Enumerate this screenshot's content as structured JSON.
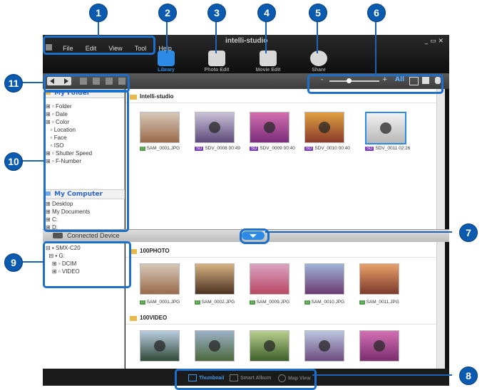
{
  "callouts": [
    "1",
    "2",
    "3",
    "4",
    "5",
    "6",
    "7",
    "8",
    "9",
    "10",
    "11"
  ],
  "app": {
    "menu": [
      "File",
      "Edit",
      "View",
      "Tool",
      "Help"
    ],
    "brand": "intelli-studio",
    "window_controls": [
      "_",
      "▭",
      "✕"
    ]
  },
  "tools": [
    {
      "label": "Library",
      "icon": "library-icon",
      "active": true
    },
    {
      "label": "Photo Edit",
      "icon": "photo-edit-icon",
      "active": false
    },
    {
      "label": "Movie Edit",
      "icon": "movie-edit-icon",
      "active": false
    },
    {
      "label": "Share",
      "icon": "share-icon",
      "active": false
    }
  ],
  "view_controls": {
    "zoom_minus": "-",
    "zoom_plus": "+",
    "all": "All"
  },
  "my_folder": {
    "title": "My Folder",
    "items": [
      "Folder",
      "Date",
      "Color",
      "Location",
      "Face",
      "ISO",
      "Shutter Speed",
      "F-Number"
    ]
  },
  "my_computer": {
    "title": "My Computer",
    "items": [
      "Desktop",
      "My Documents",
      "C:",
      "D:"
    ]
  },
  "library": {
    "folder": "Intelli-studio",
    "items": [
      {
        "type": "photo",
        "name": "SAM_0001.JPG",
        "duration": ""
      },
      {
        "type": "video",
        "name": "SDV_0008",
        "duration": "00:49"
      },
      {
        "type": "video",
        "name": "SDV_0009",
        "duration": "00:40"
      },
      {
        "type": "video",
        "name": "SDV_0010",
        "duration": "00:40"
      },
      {
        "type": "video",
        "name": "SDV_0011",
        "duration": "02:26"
      }
    ]
  },
  "device": {
    "title": "Connected Device",
    "tree": [
      "SMX-C20",
      "G:",
      "DCIM",
      "VIDEO"
    ],
    "photo_folder": "100PHOTO",
    "photos": [
      "SAM_0001.JPG",
      "SAM_0002.JPG",
      "SAM_0009.JPG",
      "SAM_0010.JPG",
      "SAM_0011.JPG"
    ],
    "video_folder": "100VIDEO"
  },
  "bottom": {
    "thumbnail": "Thumbnail",
    "smart_album": "Smart Album",
    "map_view": "Map View"
  },
  "colors": {
    "accent": "#1d6fc9",
    "callout": "#0a5bb0",
    "photo_badge": "#4d9a45",
    "video_badge": "#7b3ab5"
  }
}
